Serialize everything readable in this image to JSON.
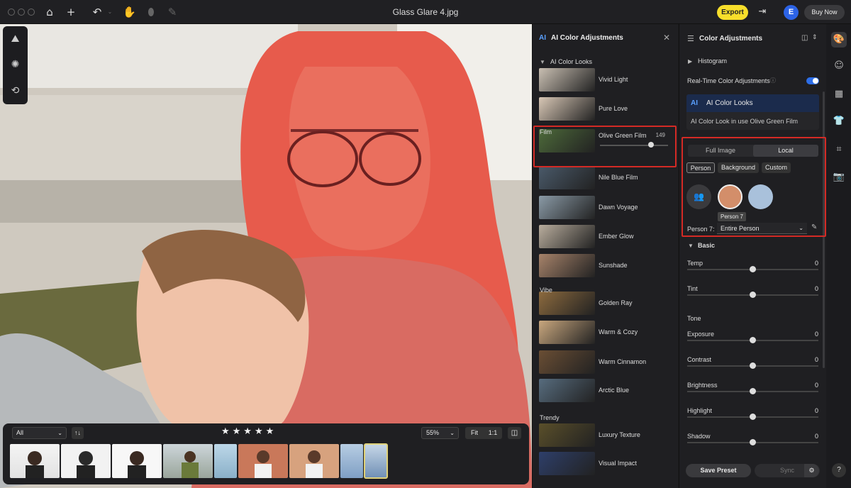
{
  "window": {
    "title": "Glass Glare 4.jpg"
  },
  "toolbar": {
    "export_label": "Export",
    "avatar_letter": "E",
    "buy_label": "Buy Now",
    "icons": [
      "home-icon",
      "plus-icon",
      "undo-icon",
      "hand-icon",
      "erase-icon",
      "pen-icon"
    ]
  },
  "filmstrip": {
    "filter_value": "All",
    "sort_label": "↑↓",
    "stars": "★★★★★",
    "zoom_value": "55%",
    "fit_label": "Fit",
    "one_to_one_label": "1:1"
  },
  "ai_panel": {
    "title": "AI Color Adjustments",
    "logo_text": "AI",
    "section_title": "AI Color Looks",
    "groups": {
      "film": "Film",
      "vibe": "Vibe",
      "trendy": "Trendy"
    },
    "looks": [
      {
        "name": "Vivid Light"
      },
      {
        "name": "Pure Love"
      },
      {
        "name": "Olive Green Film",
        "value": "149",
        "level": 0.75
      },
      {
        "name": "Nile Blue Film"
      },
      {
        "name": "Dawn Voyage"
      },
      {
        "name": "Ember Glow"
      },
      {
        "name": "Sunshade"
      },
      {
        "name": "Golden Ray"
      },
      {
        "name": "Warm & Cozy"
      },
      {
        "name": "Warm Cinnamon"
      },
      {
        "name": "Arctic Blue"
      },
      {
        "name": "Luxury Texture"
      },
      {
        "name": "Visual Impact"
      }
    ]
  },
  "color_panel": {
    "title": "Color Adjustments",
    "histogram_label": "Histogram",
    "realtime_label": "Real-Time Color Adjustments",
    "ai_looks_label": "AI Color Looks",
    "ai_look_in_use": "AI Color Look in use Olive Green Film",
    "tabs": [
      "Full Image",
      "Local"
    ],
    "targets": [
      "Person",
      "Background",
      "Custom"
    ],
    "person_tooltip": "Person 7",
    "person_label": "Person 7:",
    "person_scope": "Entire Person",
    "basic_label": "Basic",
    "tone_label": "Tone",
    "sliders_basic": [
      {
        "label": "Temp",
        "value": "0"
      },
      {
        "label": "Tint",
        "value": "0"
      }
    ],
    "sliders_tone": [
      {
        "label": "Exposure",
        "value": "0"
      },
      {
        "label": "Contrast",
        "value": "0"
      },
      {
        "label": "Brightness",
        "value": "0"
      },
      {
        "label": "Highlight",
        "value": "0"
      },
      {
        "label": "Shadow",
        "value": "0"
      }
    ],
    "save_preset_label": "Save Preset",
    "sync_label": "Sync"
  },
  "help_label": "?",
  "colors": {
    "accent": "#2d6ee8",
    "export": "#f7de2b",
    "highlight_box": "#d42a25"
  }
}
